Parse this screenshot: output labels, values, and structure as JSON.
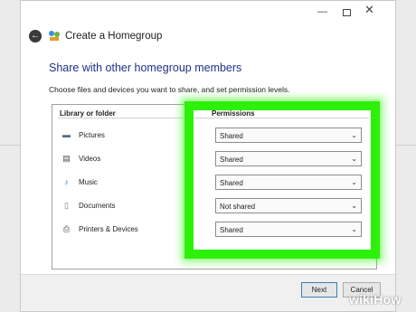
{
  "window": {
    "minimize_glyph": "—",
    "close_glyph": "✕"
  },
  "nav": {
    "back_glyph": "←",
    "title": "Create a Homegroup"
  },
  "content": {
    "heading": "Share with other homegroup members",
    "subtext": "Choose files and devices you want to share, and set permission levels."
  },
  "table": {
    "col_library": "Library or folder",
    "col_permissions": "Permissions",
    "rows": [
      {
        "label": "Pictures",
        "icon": "pictures-icon",
        "icon_glyph": "▬",
        "value": "Shared"
      },
      {
        "label": "Videos",
        "icon": "videos-icon",
        "icon_glyph": "▤",
        "value": "Shared"
      },
      {
        "label": "Music",
        "icon": "music-icon",
        "icon_glyph": "♪",
        "value": "Shared"
      },
      {
        "label": "Documents",
        "icon": "documents-icon",
        "icon_glyph": "▯",
        "value": "Not shared"
      },
      {
        "label": "Printers & Devices",
        "icon": "printer-icon",
        "icon_glyph": "⎙",
        "value": "Shared"
      }
    ],
    "chevron": "⌄"
  },
  "footer": {
    "next_label": "Next",
    "cancel_label": "Cancel"
  },
  "watermark": {
    "brand": "wiki",
    "suffix": "How"
  },
  "colors": {
    "highlight": "#2cf20a",
    "heading": "#1e3287"
  }
}
